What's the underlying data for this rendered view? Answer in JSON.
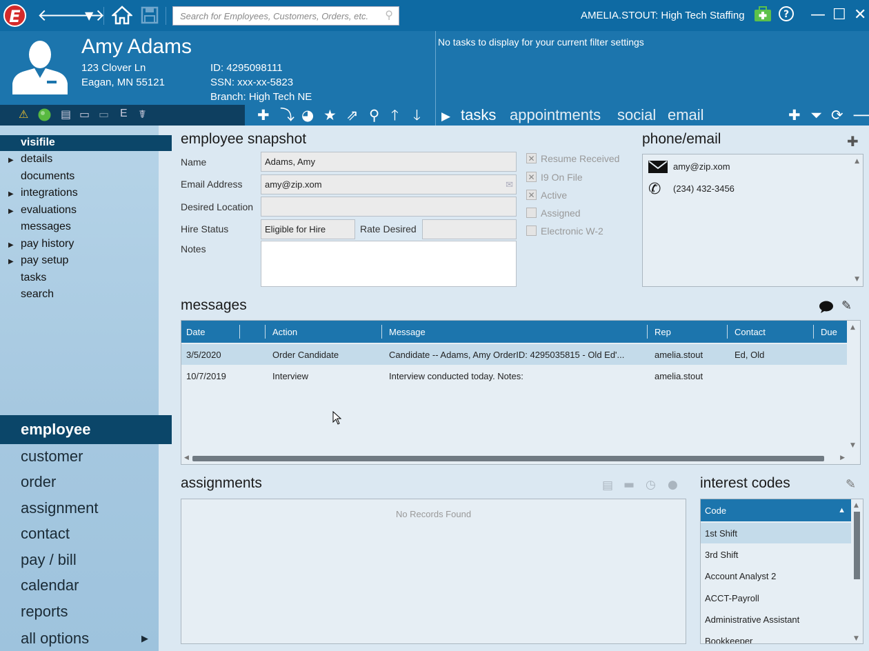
{
  "titlebar": {
    "logo_letter": "E",
    "search_placeholder": "Search for Employees, Customers, Orders, etc.",
    "user_label": "AMELIA.STOUT: High Tech Staffing"
  },
  "employee": {
    "name": "Amy Adams",
    "address1": "123 Clover Ln",
    "address2": "Eagan, MN 55121",
    "id_line": "ID: 4295098111",
    "ssn_line": "SSN: xxx-xx-5823",
    "branch_line": "Branch: High Tech NE"
  },
  "tasks_panel": {
    "empty_text": "No tasks to display for your current filter settings",
    "tabs": [
      "tasks",
      "appointments",
      "social",
      "email"
    ]
  },
  "leftnav": {
    "selected": "visifile",
    "items": [
      {
        "label": "details",
        "arrow": true
      },
      {
        "label": "documents",
        "arrow": false
      },
      {
        "label": "integrations",
        "arrow": true
      },
      {
        "label": "evaluations",
        "arrow": true
      },
      {
        "label": "messages",
        "arrow": false
      },
      {
        "label": "pay history",
        "arrow": true
      },
      {
        "label": "pay setup",
        "arrow": true
      },
      {
        "label": "tasks",
        "arrow": false
      },
      {
        "label": "search",
        "arrow": false
      }
    ],
    "big_selected": "employee",
    "big_items": [
      "customer",
      "order",
      "assignment",
      "contact",
      "pay / bill",
      "calendar",
      "reports",
      "all options"
    ]
  },
  "snapshot": {
    "title": "employee snapshot",
    "name_label": "Name",
    "name_value": "Adams, Amy",
    "email_label": "Email Address",
    "email_value": "amy@zip.xom",
    "location_label": "Desired Location",
    "location_value": "",
    "hire_label": "Hire Status",
    "hire_value": "Eligible for Hire",
    "rate_label": "Rate Desired",
    "rate_value": "",
    "notes_label": "Notes",
    "notes_value": "",
    "checkboxes": [
      {
        "label": "Resume Received",
        "checked": true
      },
      {
        "label": "I9 On File",
        "checked": true
      },
      {
        "label": "Active",
        "checked": true
      },
      {
        "label": "Assigned",
        "checked": false
      },
      {
        "label": "Electronic W-2",
        "checked": false
      }
    ]
  },
  "phone_email": {
    "title": "phone/email",
    "email": "amy@zip.xom",
    "phone": "(234) 432-3456"
  },
  "messages": {
    "title": "messages",
    "columns": [
      "Date",
      "Action",
      "Message",
      "Rep",
      "Contact",
      "Due"
    ],
    "rows": [
      {
        "date": "3/5/2020",
        "action": "Order Candidate",
        "message": "Candidate  --  Adams, Amy     OrderID: 4295035815 - Old Ed'...",
        "rep": "amelia.stout",
        "contact": "Ed, Old",
        "due": ""
      },
      {
        "date": "10/7/2019",
        "action": "Interview",
        "message": "Interview conducted today. Notes:",
        "rep": "amelia.stout",
        "contact": "",
        "due": ""
      }
    ]
  },
  "assignments": {
    "title": "assignments",
    "empty_text": "No Records Found"
  },
  "interest_codes": {
    "title": "interest codes",
    "column": "Code",
    "rows": [
      "1st Shift",
      "3rd Shift",
      "Account Analyst 2",
      "ACCT-Payroll",
      "Administrative Assistant",
      "Bookkeeper"
    ]
  },
  "colors": {
    "header_blue": "#1c75ad",
    "dark_navy": "#0b4669",
    "title_bar": "#0e6aa3",
    "content_bg": "#dbe8f2"
  }
}
